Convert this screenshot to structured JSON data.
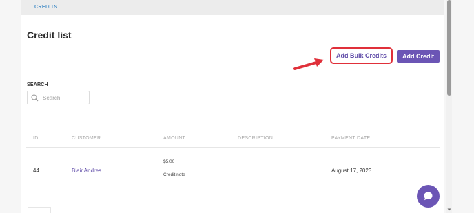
{
  "breadcrumb": "CREDITS",
  "page_title": "Credit list",
  "buttons": {
    "bulk_label": "Add Bulk Credits",
    "add_label": "Add Credit"
  },
  "search": {
    "label": "SEARCH",
    "placeholder": "Search",
    "value": ""
  },
  "table": {
    "columns": [
      "ID",
      "CUSTOMER",
      "AMOUNT",
      "DESCRIPTION",
      "PAYMENT DATE"
    ],
    "rows": [
      {
        "id": "44",
        "customer": "Blair Andres",
        "amount": "$5.00",
        "amount_note": "Credit note",
        "description": "",
        "payment_date": "August 17, 2023"
      }
    ]
  },
  "icons": {
    "search": "search-icon",
    "chat": "chat-icon",
    "annotation_arrow": "red-arrow"
  },
  "colors": {
    "accent": "#6b55b5",
    "annotation": "#e0303a",
    "breadcrumb": "#4a90c8"
  }
}
